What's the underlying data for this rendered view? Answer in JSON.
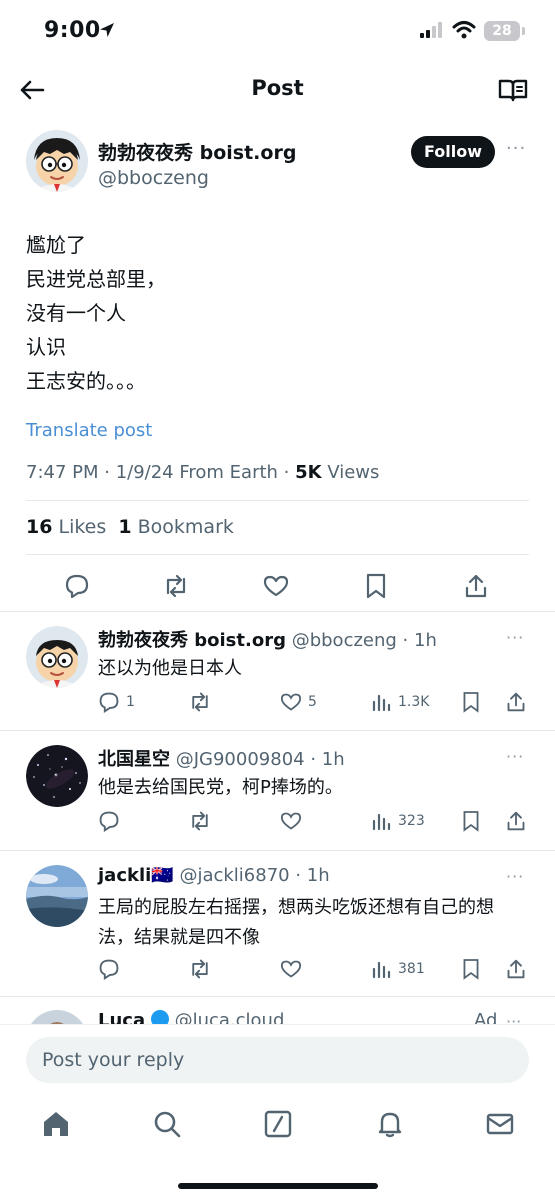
{
  "status_bar": {
    "time": "9:00",
    "battery": "28"
  },
  "header": {
    "title": "Post"
  },
  "post": {
    "author_name": "勃勃夜夜秀 boist.org",
    "author_handle": "@bboczeng",
    "follow_label": "Follow",
    "more_label": "···",
    "text_lines": [
      "尷尬了",
      "民进党总部里，",
      "没有一个人",
      "认识",
      "王志安的。。。"
    ],
    "translate_label": "Translate post",
    "meta_prefix": "7:47 PM · 1/9/24 From Earth · ",
    "views_count": "5K",
    "views_label": " Views",
    "likes_count": "16",
    "likes_label": " Likes  ",
    "bookmarks_count": "1",
    "bookmarks_label": " Bookmark"
  },
  "replies": [
    {
      "name": "勃勃夜夜秀 boist.org",
      "handle_time": " @bboczeng · 1h",
      "text": "还以为他是日本人",
      "comments": "1",
      "likes": "5",
      "views": "1.3K"
    },
    {
      "name": "北国星空",
      "handle_time": " @JG90009804 · 1h",
      "text": "他是去给国民党，柯P捧场的。",
      "comments": "",
      "likes": "",
      "views": "323"
    },
    {
      "name": "jackli🇦🇺",
      "handle_time": " @jackli6870 · 1h",
      "text": "王局的屁股左右摇摆，想两头吃饭还想有自己的想法，结果就是四不像",
      "comments": "",
      "likes": "",
      "views": "381"
    }
  ],
  "ad_preview": {
    "name": "Luca",
    "handle": " @luca.cloud",
    "ad_label": "Ad"
  },
  "composer": {
    "placeholder": "Post your reply"
  },
  "colors": {
    "link": "#4a8fd4",
    "secondary_text": "#536471",
    "primary_text": "#0f1419",
    "verified": "#1d9bf0"
  }
}
